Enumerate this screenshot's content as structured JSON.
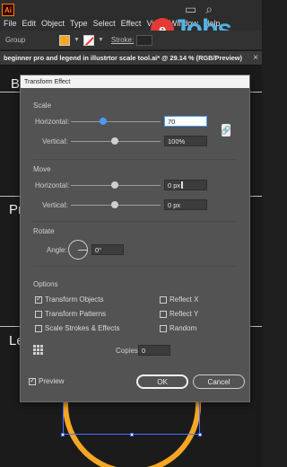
{
  "menubar": {
    "logo": "Ai",
    "items": [
      "File",
      "Edit",
      "Object",
      "Type",
      "Select",
      "Effect",
      "View",
      "Window",
      "Help"
    ]
  },
  "watermark": {
    "prefix": "e",
    "text": "Jobs"
  },
  "controlbar": {
    "group_label": "Group",
    "fill_color": "#f5a623",
    "stroke_label": "Stroke:"
  },
  "document": {
    "tab_title": "beginner pro and legend in illustrtor scale tool.ai* @ 29.14 % (RGB/Preview)",
    "close": "×"
  },
  "canvas": {
    "letters": [
      "B",
      "Pr",
      "Le"
    ]
  },
  "dialog": {
    "title": "Transform Effect",
    "scale": {
      "section": "Scale",
      "horizontal_label": "Horizontal:",
      "horizontal_value": "70",
      "vertical_label": "Vertical:",
      "vertical_value": "100%",
      "link_icon": "🔗"
    },
    "move": {
      "section": "Move",
      "horizontal_label": "Horizontal:",
      "horizontal_value": "0 px",
      "vertical_label": "Vertical:",
      "vertical_value": "0 px"
    },
    "rotate": {
      "section": "Rotate",
      "angle_label": "Angle:",
      "angle_value": "0°"
    },
    "options": {
      "section": "Options",
      "transform_objects": "Transform Objects",
      "transform_patterns": "Transform Patterns",
      "scale_strokes": "Scale Strokes & Effects",
      "reflect_x": "Reflect X",
      "reflect_y": "Reflect Y",
      "random": "Random",
      "transform_objects_checked": true
    },
    "copies_label": "Copies",
    "copies_value": "0",
    "preview_label": "Preview",
    "preview_checked": true,
    "ok_label": "OK",
    "cancel_label": "Cancel"
  }
}
